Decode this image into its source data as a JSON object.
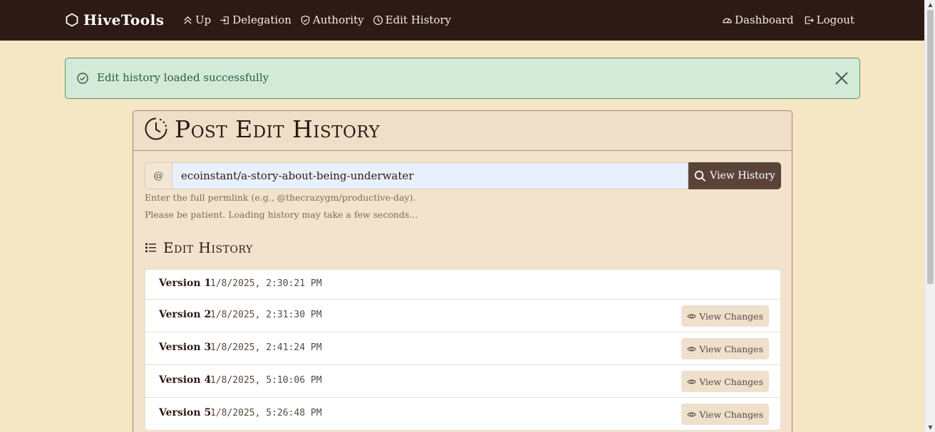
{
  "nav": {
    "brand": "HiveTools",
    "links_left": [
      {
        "label": "Up",
        "icon": "chevrons-up-icon"
      },
      {
        "label": "Delegation",
        "icon": "login-arrow-icon"
      },
      {
        "label": "Authority",
        "icon": "shield-check-icon"
      },
      {
        "label": "Edit History",
        "icon": "clock-history-icon"
      }
    ],
    "links_right": [
      {
        "label": "Dashboard",
        "icon": "speedometer-icon"
      },
      {
        "label": "Logout",
        "icon": "logout-icon"
      }
    ]
  },
  "alert": {
    "message": "Edit history loaded successfully"
  },
  "card": {
    "title": "Post Edit History",
    "search": {
      "prefix": "@",
      "value": "ecoinstant/a-story-about-being-underwater",
      "button_label": "View History"
    },
    "help_text_1": "Enter the full permlink (e.g., @thecrazygm/productive-day).",
    "help_text_2": "Please be patient. Loading history may take a few seconds...",
    "section_title": "Edit History",
    "versions": [
      {
        "label": "Version 1",
        "timestamp": "1/8/2025, 2:30:21 PM",
        "has_changes": false
      },
      {
        "label": "Version 2",
        "timestamp": "1/8/2025, 2:31:30 PM",
        "has_changes": true
      },
      {
        "label": "Version 3",
        "timestamp": "1/8/2025, 2:41:24 PM",
        "has_changes": true
      },
      {
        "label": "Version 4",
        "timestamp": "1/8/2025, 5:10:06 PM",
        "has_changes": true
      },
      {
        "label": "Version 5",
        "timestamp": "1/8/2025, 5:26:48 PM",
        "has_changes": true
      }
    ],
    "view_changes_label": "View Changes"
  },
  "colors": {
    "navbar": "#2d1a14",
    "page_bg": "#f5e6c4",
    "alert_bg": "#d3ead9",
    "button_dark": "#5a4339"
  }
}
